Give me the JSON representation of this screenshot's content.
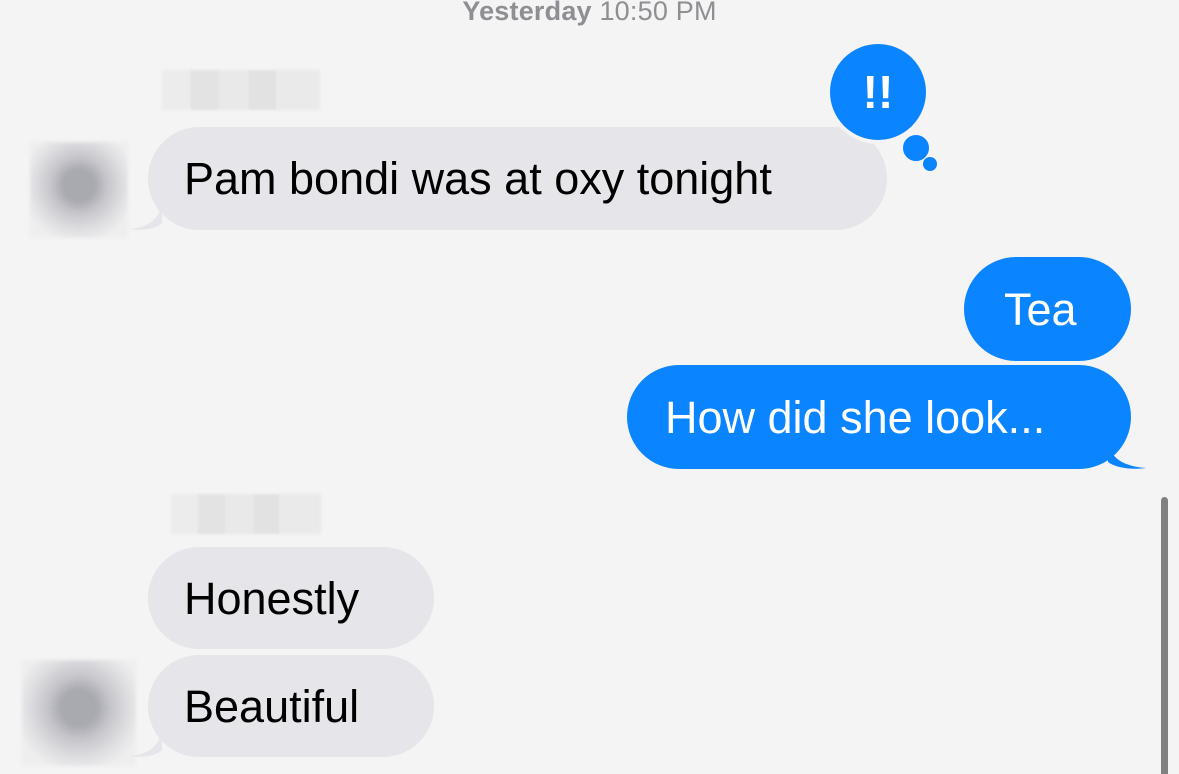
{
  "timestamp": {
    "day": "Yesterday",
    "time": "10:50 PM"
  },
  "messages": [
    {
      "direction": "incoming",
      "text": "Pam bondi was at oxy tonight",
      "tapback": "!!"
    },
    {
      "direction": "outgoing",
      "text": "Tea"
    },
    {
      "direction": "outgoing",
      "text": "How did she look..."
    },
    {
      "direction": "incoming",
      "text": "Honestly"
    },
    {
      "direction": "incoming",
      "text": "Beautiful"
    }
  ],
  "colors": {
    "background": "#f4f4f4",
    "incoming_bubble": "#e5e5ea",
    "outgoing_bubble": "#0a84ff",
    "timestamp_text": "#8e8e93"
  }
}
